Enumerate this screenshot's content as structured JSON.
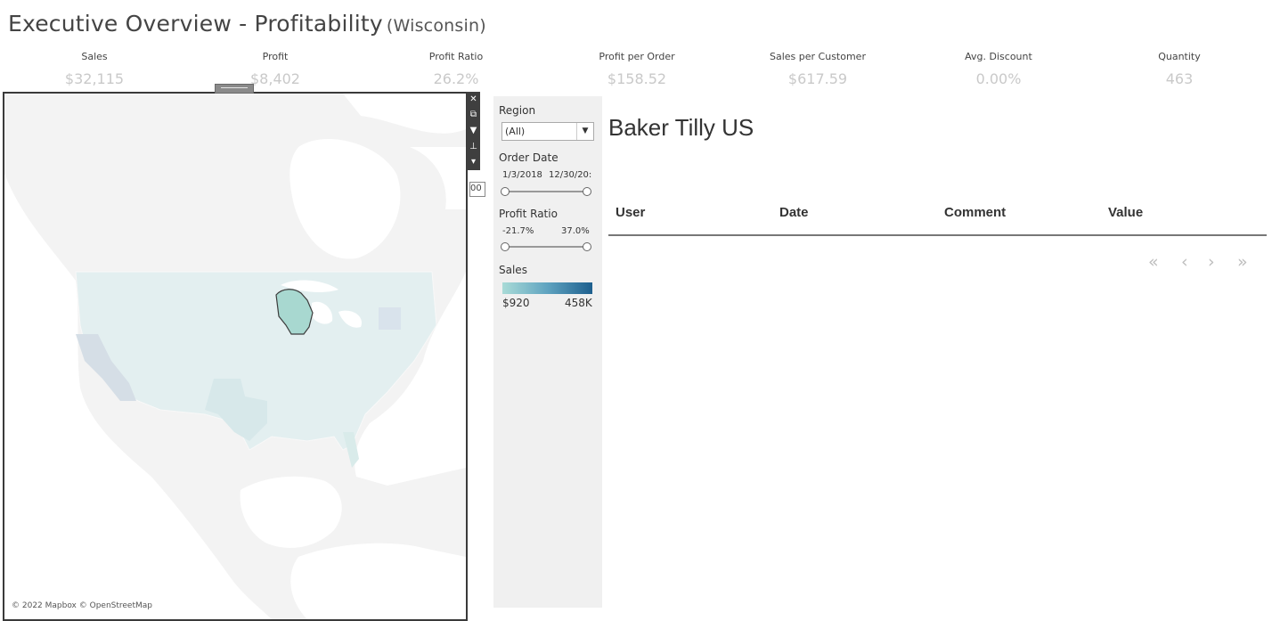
{
  "header": {
    "title": "Executive Overview - Profitability",
    "subtitle": "(Wisconsin)"
  },
  "kpis": [
    {
      "label": "Sales",
      "value": "$32,115"
    },
    {
      "label": "Profit",
      "value": "$8,402"
    },
    {
      "label": "Profit Ratio",
      "value": "26.2%"
    },
    {
      "label": "Profit per Order",
      "value": "$158.52"
    },
    {
      "label": "Sales per Customer",
      "value": "$617.59"
    },
    {
      "label": "Avg. Discount",
      "value": "0.00%"
    },
    {
      "label": "Quantity",
      "value": "463"
    }
  ],
  "map": {
    "attribution": "© 2022 Mapbox © OpenStreetMap",
    "highlighted_state": "Wisconsin",
    "peek_value": "00"
  },
  "toolbar_icons": [
    "close-icon",
    "popout-icon",
    "filter-icon",
    "pin-icon",
    "more-icon"
  ],
  "filters": {
    "region": {
      "label": "Region",
      "value": "(All)"
    },
    "order_date": {
      "label": "Order Date",
      "start": "1/3/2018",
      "end": "12/30/20:"
    },
    "profit_ratio": {
      "label": "Profit Ratio",
      "min": "-21.7%",
      "max": "37.0%"
    },
    "sales_legend": {
      "label": "Sales",
      "min": "$920",
      "max": "458K"
    }
  },
  "colors": {
    "legend_low": "#a9dbd7",
    "legend_high": "#1d5f8e",
    "highlight": "#a8d8d0"
  },
  "comments": {
    "org_name": "Baker Tilly US",
    "columns": [
      "User",
      "Date",
      "Comment",
      "Value"
    ],
    "rows": [],
    "pager": {
      "first": "«",
      "prev": "‹",
      "next": "›",
      "last": "»"
    }
  }
}
